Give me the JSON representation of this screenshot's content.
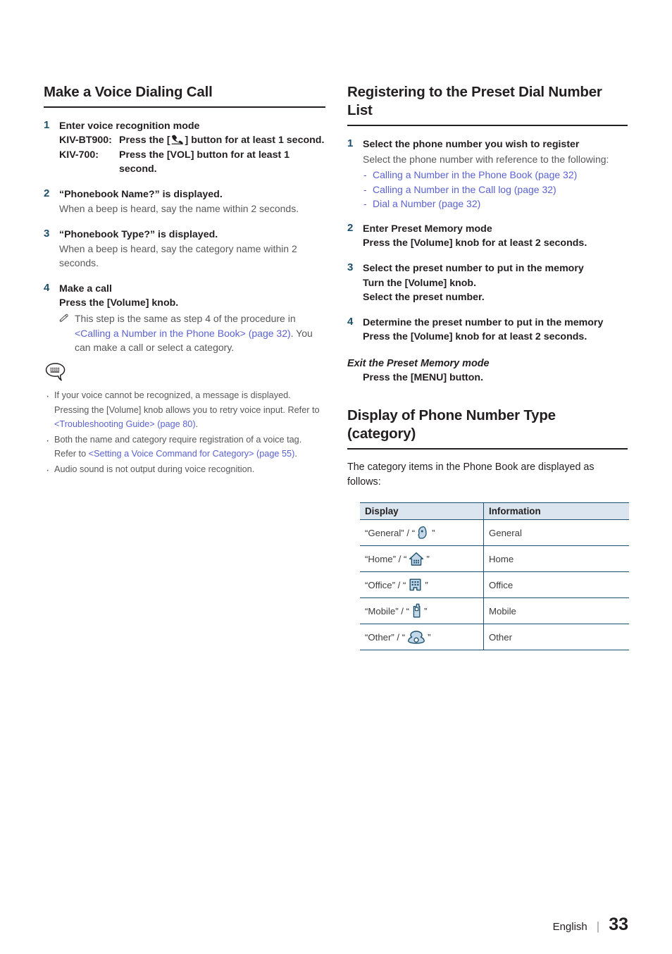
{
  "page": {
    "language": "English",
    "number": "33"
  },
  "colors": {
    "step_number": "#1c4f6b",
    "link": "#5a62d1",
    "table_header_bg": "#dbe5ef",
    "table_border": "#1c4f6b",
    "icon_fill": "#c3d7e8",
    "icon_stroke": "#1c4f6b",
    "body_text": "#231f20",
    "muted_text": "#58585b"
  },
  "left_column": {
    "heading": "Make a Voice Dialing Call",
    "steps": [
      {
        "num": "1",
        "title": "Enter voice recognition mode",
        "models": [
          {
            "name": "KIV-BT900:",
            "text_before": "Press the [",
            "icon": "phone-handset-icon",
            "text_after": "] button for at least 1 second."
          },
          {
            "name": "KIV-700:",
            "text_before": "",
            "icon": "",
            "text_after": "Press the [VOL] button for at least 1 second."
          }
        ]
      },
      {
        "num": "2",
        "title": "“Phonebook Name?” is displayed.",
        "desc": "When a beep is heard, say the name within 2 seconds."
      },
      {
        "num": "3",
        "title": "“Phonebook Type?” is displayed.",
        "desc": "When a beep is heard, say the category name within 2 seconds."
      },
      {
        "num": "4",
        "title": "Make a call",
        "subtitle": "Press the [Volume] knob.",
        "pencil_note": {
          "icon": "pencil-icon",
          "text_1": "This step is the same as step 4 of the procedure in ",
          "link_1": "<Calling a Number in the Phone Book> (page 32)",
          "text_2": ". You can make a call or select a category."
        }
      }
    ],
    "bubble_icon": "speech-bubble-note-icon",
    "notes": [
      {
        "text_1": "If your voice cannot be recognized, a message is displayed. Pressing the [Volume] knob allows you to retry voice input. Refer to ",
        "link_1": "<Troubleshooting Guide> (page 80)",
        "text_2": "."
      },
      {
        "text_1": "Both the name and category require registration of a voice tag. Refer to ",
        "link_1": "<Setting a Voice Command for Category> (page 55)",
        "text_2": "."
      },
      {
        "text_1": "Audio sound is not output during voice recognition.",
        "link_1": "",
        "text_2": ""
      }
    ]
  },
  "right_column": {
    "heading_1": "Registering to the Preset Dial Number List",
    "steps": [
      {
        "num": "1",
        "title": "Select the phone number you wish to register",
        "desc": "Select the phone number with reference to the following:",
        "links": [
          "Calling a Number in the Phone Book (page 32)",
          "Calling a Number in the Call log (page 32)",
          "Dial a Number (page 32)"
        ]
      },
      {
        "num": "2",
        "title": "Enter Preset Memory mode",
        "lines": [
          "Press the [Volume] knob for at least 2 seconds."
        ]
      },
      {
        "num": "3",
        "title": "Select the preset number to put in the memory",
        "lines": [
          "Turn the [Volume] knob.",
          "Select the preset number."
        ]
      },
      {
        "num": "4",
        "title": "Determine the preset number to put in the memory",
        "lines": [
          "Press the [Volume] knob for at least 2 seconds."
        ]
      }
    ],
    "exit": {
      "title": "Exit the Preset Memory mode",
      "body": "Press the [MENU] button."
    },
    "heading_2": "Display of Phone Number Type (category)",
    "lead": "The category items in the Phone Book are displayed as follows:",
    "table": {
      "headers": [
        "Display",
        "Information"
      ],
      "rows": [
        {
          "label_prefix": "“General” / “",
          "icon": "person-head-icon",
          "label_suffix": "”",
          "information": "General"
        },
        {
          "label_prefix": "“Home” / “",
          "icon": "house-icon",
          "label_suffix": "”",
          "information": "Home"
        },
        {
          "label_prefix": "“Office” / “",
          "icon": "office-building-icon",
          "label_suffix": "”",
          "information": "Office"
        },
        {
          "label_prefix": "“Mobile” / “",
          "icon": "mobile-phone-icon",
          "label_suffix": "”",
          "information": "Mobile"
        },
        {
          "label_prefix": "“Other” / “",
          "icon": "desk-telephone-icon",
          "label_suffix": "”",
          "information": "Other"
        }
      ]
    }
  }
}
